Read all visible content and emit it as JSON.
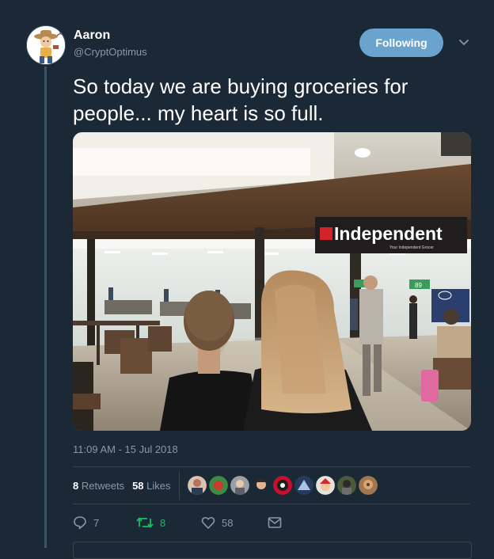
{
  "author": {
    "name": "Aaron",
    "handle": "@CryptOptimus"
  },
  "follow_button": {
    "label": "Following"
  },
  "tweet": {
    "text": "So today we are buying groceries for people... my heart is so full."
  },
  "media": {
    "store_sign": "Independent",
    "store_tagline": "Your Independent Grocer",
    "checkout_sign": "89"
  },
  "meta": {
    "timestamp": "11:09 AM - 15 Jul 2018"
  },
  "stats": {
    "retweets_count": "8",
    "retweets_label": "Retweets",
    "likes_count": "58",
    "likes_label": "Likes"
  },
  "actions": {
    "reply_count": "7",
    "retweet_count": "8",
    "like_count": "58"
  },
  "colors": {
    "background": "#1b2836",
    "follow_button": "#6ba3cf",
    "retweet_active": "#17bf63",
    "muted": "#8899a6"
  },
  "icons": {
    "reply": "reply-icon",
    "retweet": "retweet-icon",
    "like": "heart-icon",
    "message": "envelope-icon",
    "caret": "chevron-down-icon"
  }
}
